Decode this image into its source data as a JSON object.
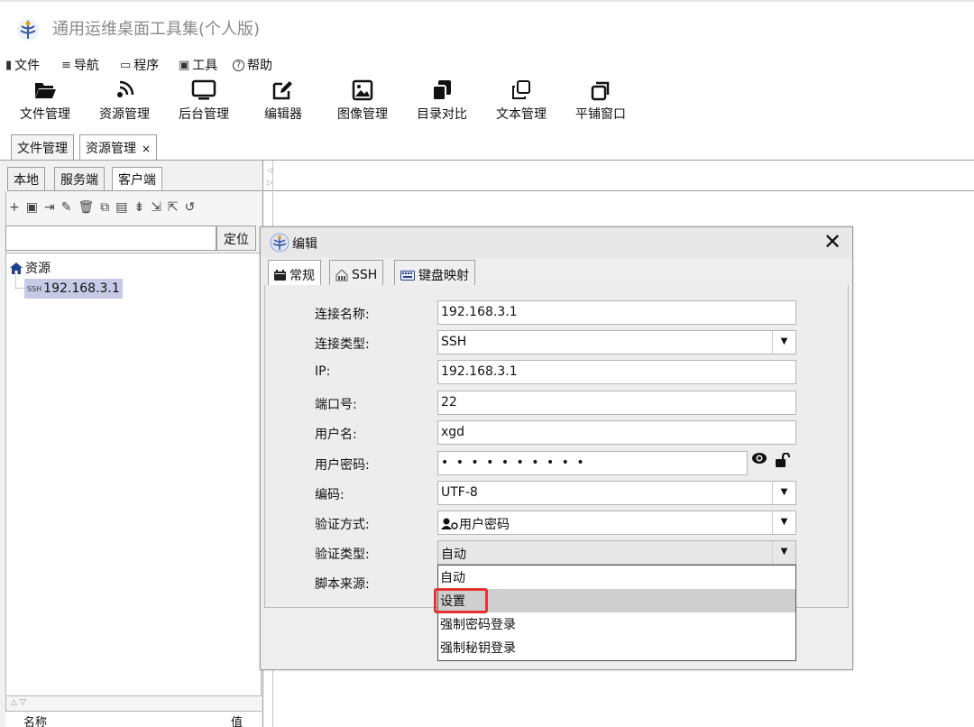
{
  "app": {
    "title": "通用运维桌面工具集(个人版)"
  },
  "menu": [
    {
      "icon": "file-icon",
      "glyph": "▮",
      "label": "文件"
    },
    {
      "icon": "nav-icon",
      "glyph": "≡",
      "label": "导航"
    },
    {
      "icon": "program-icon",
      "glyph": "▭",
      "label": "程序"
    },
    {
      "icon": "tools-icon",
      "glyph": "▣",
      "label": "工具"
    },
    {
      "icon": "help-icon",
      "glyph": "?",
      "label": "帮助"
    }
  ],
  "toolbar": [
    {
      "label": "文件管理",
      "icon": "folder-open-icon"
    },
    {
      "label": "资源管理",
      "icon": "signal-icon"
    },
    {
      "label": "后台管理",
      "icon": "monitor-icon"
    },
    {
      "label": "编辑器",
      "icon": "edit-icon"
    },
    {
      "label": "图像管理",
      "icon": "image-icon"
    },
    {
      "label": "目录对比",
      "icon": "copy-icon"
    },
    {
      "label": "文本管理",
      "icon": "clone-icon"
    },
    {
      "label": "平铺窗口",
      "icon": "window-restore-icon"
    }
  ],
  "doc_tabs": [
    {
      "label": "文件管理"
    },
    {
      "label": "资源管理",
      "close": "×"
    }
  ],
  "left_tabs": [
    {
      "label": "本地"
    },
    {
      "label": "服务端"
    },
    {
      "label": "客户端"
    }
  ],
  "left_toolbar": [
    "+",
    "▣",
    "⇥",
    "✎",
    "🗑",
    "⧉",
    "▤",
    "⇟",
    "⇲",
    "⇱",
    "↺"
  ],
  "locate_button": "定位",
  "tree": {
    "root": "资源",
    "child_badge": "SSH",
    "child": "192.168.3.1"
  },
  "left_columns": {
    "name": "名称",
    "value": "值"
  },
  "dialog": {
    "title": "编辑",
    "close": "✕",
    "tabs": [
      {
        "label": "常规",
        "icon": "calendar-icon"
      },
      {
        "label": "SSH",
        "icon": "ssh-icon"
      },
      {
        "label": "键盘映射",
        "icon": "keyboard-icon"
      }
    ],
    "fields": {
      "name_label": "连接名称:",
      "name_value": "192.168.3.1",
      "type_label": "连接类型:",
      "type_value": "SSH",
      "ip_label": "IP:",
      "ip_value": "192.168.3.1",
      "port_label": "端口号:",
      "port_value": "22",
      "user_label": "用户名:",
      "user_value": "xgd",
      "password_label": "用户密码:",
      "password_value": "• • • • • • • • • •",
      "encoding_label": "编码:",
      "encoding_value": "UTF-8",
      "auth_method_label": "验证方式:",
      "auth_method_value": "用户密码",
      "auth_type_label": "验证类型:",
      "auth_type_value": "自动",
      "script_label": "脚本来源:"
    },
    "auth_type_options": [
      "自动",
      "设置",
      "强制密码登录",
      "强制秘钥登录"
    ],
    "hovered_option": "设置"
  },
  "colors": {
    "highlight": "#e53230",
    "selection": "#c6cae6"
  }
}
